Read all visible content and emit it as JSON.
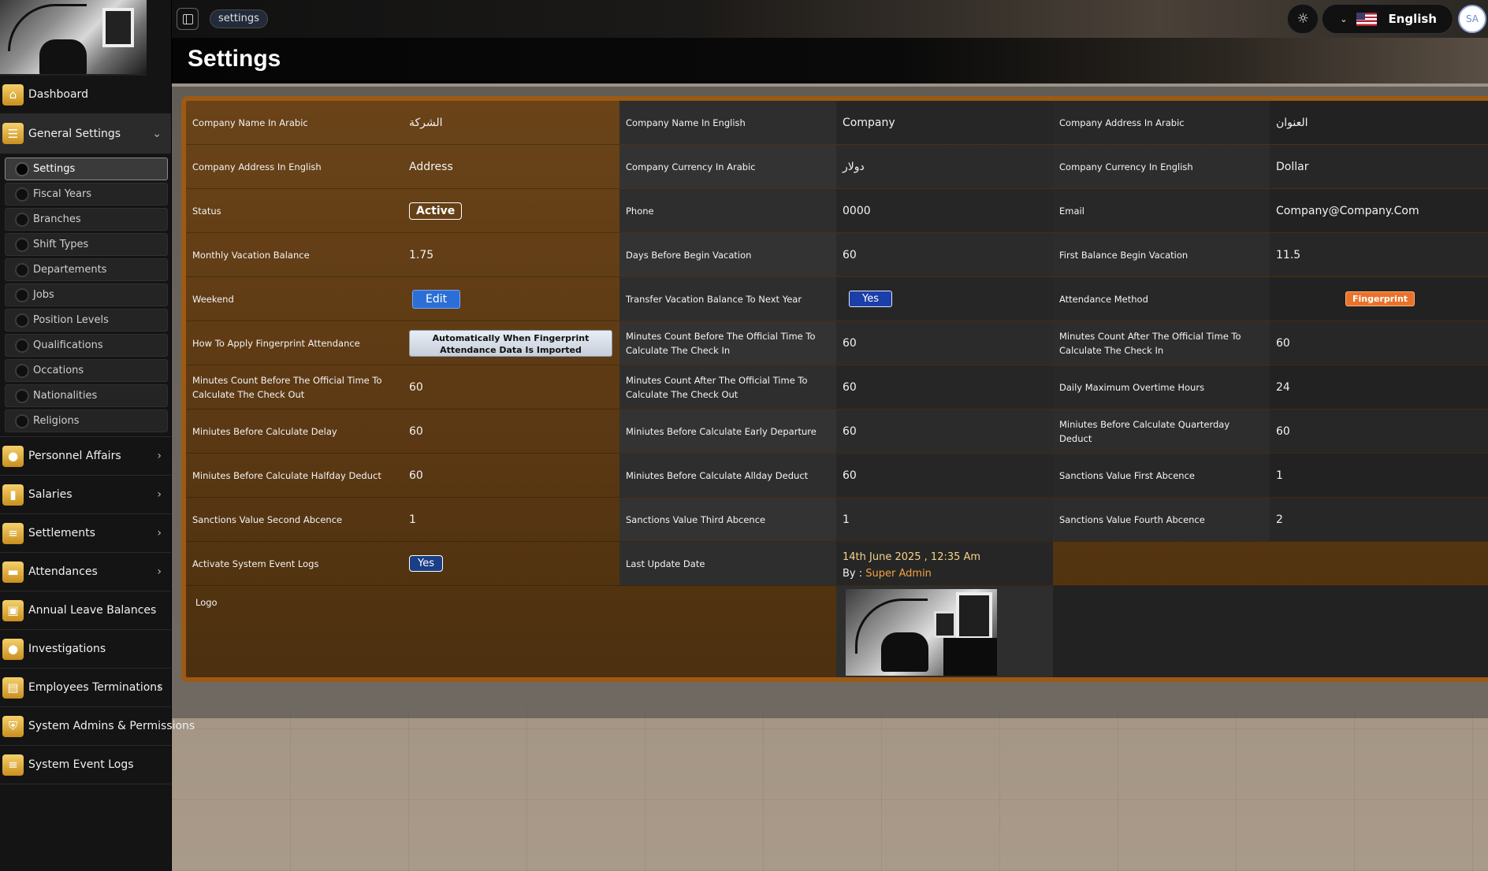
{
  "breadcrumb": "settings",
  "page_title": "Settings",
  "language": "English",
  "user_initials": "SA",
  "sidebar": {
    "items": [
      {
        "label": "Dashboard",
        "icon": "home-icon"
      },
      {
        "label": "General Settings",
        "icon": "sliders-icon"
      },
      {
        "label": "Personnel Affairs",
        "icon": "users-icon"
      },
      {
        "label": "Salaries",
        "icon": "chart-icon"
      },
      {
        "label": "Settlements",
        "icon": "list-icon"
      },
      {
        "label": "Attendances",
        "icon": "briefcase-icon"
      },
      {
        "label": "Annual Leave Balances",
        "icon": "luggage-icon"
      },
      {
        "label": "Investigations",
        "icon": "circle-icon"
      },
      {
        "label": "Employees Terminations",
        "icon": "document-icon"
      },
      {
        "label": "System Admins & Permissions",
        "icon": "shield-icon"
      },
      {
        "label": "System Event Logs",
        "icon": "list-icon"
      }
    ],
    "general_settings_children": [
      "Settings",
      "Fiscal Years",
      "Branches",
      "Shift Types",
      "Departements",
      "Jobs",
      "Position Levels",
      "Qualifications",
      "Occations",
      "Nationalities",
      "Religions"
    ]
  },
  "settings": {
    "rows": [
      [
        {
          "label": "Company Name In Arabic",
          "value": "الشركة"
        },
        {
          "label": "Company Name In English",
          "value": "Company"
        },
        {
          "label": "Company Address In Arabic",
          "value": "العنوان"
        }
      ],
      [
        {
          "label": "Company Address In English",
          "value": "Address"
        },
        {
          "label": "Company Currency In Arabic",
          "value": "دولار"
        },
        {
          "label": "Company Currency In English",
          "value": "Dollar"
        }
      ],
      [
        {
          "label": "Status",
          "value": "Active"
        },
        {
          "label": "Phone",
          "value": "0000"
        },
        {
          "label": "Email",
          "value": "Company@Company.Com"
        }
      ],
      [
        {
          "label": "Monthly Vacation Balance",
          "value": "1.75"
        },
        {
          "label": "Days Before Begin Vacation",
          "value": "60"
        },
        {
          "label": "First Balance Begin Vacation",
          "value": "11.5"
        }
      ],
      [
        {
          "label": "Weekend",
          "value": "Edit"
        },
        {
          "label": "Transfer Vacation Balance To Next Year",
          "value": "Yes"
        },
        {
          "label": "Attendance Method",
          "value": "Fingerprint"
        }
      ],
      [
        {
          "label": "How To Apply Fingerprint Attendance",
          "value": "Automatically When Fingerprint Attendance Data Is Imported"
        },
        {
          "label": "Minutes Count Before The Official Time To Calculate The Check In",
          "value": "60"
        },
        {
          "label": "Minutes Count After The Official Time To Calculate The Check In",
          "value": "60"
        }
      ],
      [
        {
          "label": "Minutes Count Before The Official Time To Calculate The Check Out",
          "value": "60"
        },
        {
          "label": "Minutes Count After The Official Time To Calculate The Check Out",
          "value": "60"
        },
        {
          "label": "Daily Maximum Overtime Hours",
          "value": "24"
        }
      ],
      [
        {
          "label": "Miniutes Before Calculate Delay",
          "value": "60"
        },
        {
          "label": "Miniutes Before Calculate Early Departure",
          "value": "60"
        },
        {
          "label": "Miniutes Before Calculate Quarterday Deduct",
          "value": "60"
        }
      ],
      [
        {
          "label": "Miniutes Before Calculate Halfday Deduct",
          "value": "60"
        },
        {
          "label": "Miniutes Before Calculate Allday Deduct",
          "value": "60"
        },
        {
          "label": "Sanctions Value First Abcence",
          "value": "1"
        }
      ],
      [
        {
          "label": "Sanctions Value Second Abcence",
          "value": "1"
        },
        {
          "label": "Sanctions Value Third Abcence",
          "value": "1"
        },
        {
          "label": "Sanctions Value Fourth Abcence",
          "value": "2"
        }
      ]
    ],
    "event_logs": {
      "label": "Activate System Event Logs",
      "value": "Yes"
    },
    "last_update": {
      "label": "Last Update Date",
      "date": "14th June 2025 , 12:35 Am",
      "by_prefix": "By :",
      "by_name": "Super Admin"
    },
    "logo_label": "Logo"
  }
}
